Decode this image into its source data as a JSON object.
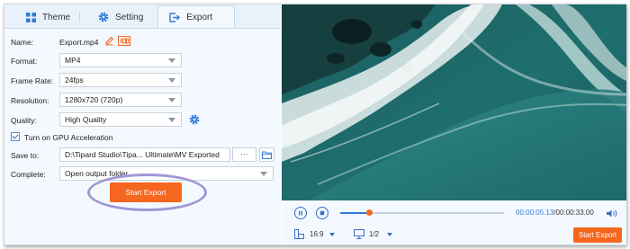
{
  "tabs": [
    {
      "label": "Theme",
      "icon": "grid-icon"
    },
    {
      "label": "Setting",
      "icon": "gear-icon"
    },
    {
      "label": "Export",
      "icon": "export-icon",
      "active": true
    }
  ],
  "form": {
    "name_label": "Name:",
    "name_value": "Export.mp4",
    "format_label": "Format:",
    "format_value": "MP4",
    "frame_rate_label": "Frame Rate:",
    "frame_rate_value": "24fps",
    "resolution_label": "Resolution:",
    "resolution_value": "1280x720 (720p)",
    "quality_label": "Quality:",
    "quality_value": "High Quality",
    "gpu_label": "Turn on GPU Acceleration",
    "gpu_checked": true,
    "save_to_label": "Save to:",
    "save_to_value": "D:\\Tipard Studio\\Tipa... Ultimate\\MV Exported",
    "browse_label": "···",
    "complete_label": "Complete:",
    "complete_value": "Open output folder"
  },
  "start_export_label": "Start Export",
  "player": {
    "current_time": "00:00:05.13",
    "separator": "/",
    "total_time": "00:00:33.00",
    "progress": 0.18,
    "aspect_ratio": "16:9",
    "split_value": "1/2",
    "export_label": "Start Export"
  },
  "colors": {
    "accent": "#f5661f",
    "link_blue": "#2f7bd9",
    "panel_bg": "#f4f9ff"
  }
}
